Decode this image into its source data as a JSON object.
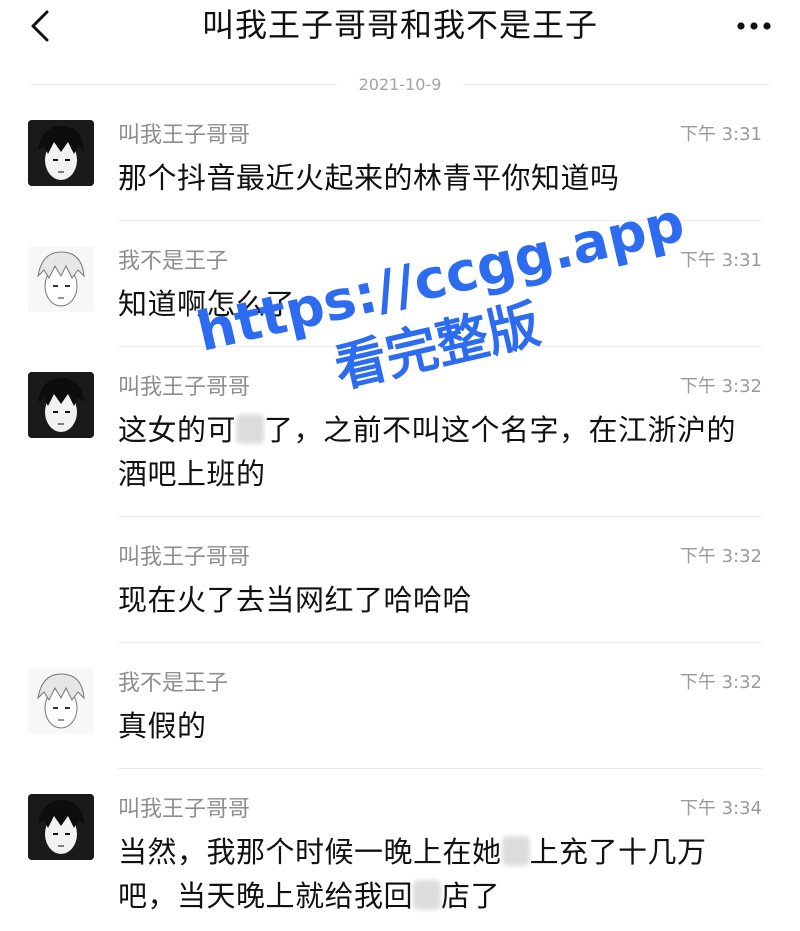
{
  "header": {
    "title": "叫我王子哥哥和我不是王子"
  },
  "date_divider": "2021-10-9",
  "messages": [
    {
      "sender": "叫我王子哥哥",
      "time": "下午 3:31",
      "text_parts": [
        "那个抖音最近火起来的林青平你知道吗"
      ]
    },
    {
      "sender": "我不是王子",
      "time": "下午 3:31",
      "text_parts": [
        "知道啊怎么了"
      ]
    },
    {
      "sender": "叫我王子哥哥",
      "time": "下午 3:32",
      "text_parts": [
        "这女的可",
        "了，之前不叫这个名字，在江浙沪的酒吧上班的"
      ]
    },
    {
      "sender": "叫我王子哥哥",
      "time": "下午 3:32",
      "text_parts": [
        "现在火了去当网红了哈哈哈"
      ]
    },
    {
      "sender": "我不是王子",
      "time": "下午 3:32",
      "text_parts": [
        "真假的"
      ]
    },
    {
      "sender": "叫我王子哥哥",
      "time": "下午 3:34",
      "text_parts": [
        "当然，我那个时候一晚上在她",
        "上充了十几万吧，当天晚上就给我回",
        "店了"
      ]
    }
  ],
  "watermark": {
    "line1": "https://ccgg.app",
    "line2": "看完整版"
  },
  "colors": {
    "watermark": "#2d6cf0",
    "meta_text": "#9a9a9a"
  }
}
